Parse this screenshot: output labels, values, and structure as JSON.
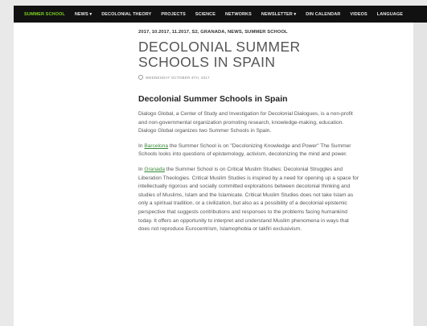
{
  "nav": {
    "items": [
      "SUMMER SCHOOL",
      "NEWS ▾",
      "DECOLONIAL THEORY",
      "PROJECTS",
      "SCIENCE",
      "NETWORKS",
      "NEWSLETTER ▾",
      "DIN CALENDAR",
      "VIDEOS",
      "LANGUAGE"
    ]
  },
  "post": {
    "meta": "2017, 10.2017, 11.2017, S2, GRANADA, NEWS, SUMMER SCHOOL",
    "title": "DECOLONIAL SUMMER SCHOOLS IN SPAIN",
    "date": "WEDNESDAY OCTOBER 4TH, 2017",
    "heading": "Decolonial Summer Schools in Spain",
    "p1": "Dialogo Global, a Center of Study and Investigation for Decolonial Dialogues, is a non-profit and non-governmental organization promoting research, knowledge-making, education. Dialogo Global organizes two Summer Schools in Spain.",
    "p2_prefix": "In ",
    "p2_link": "Barcelona",
    "p2_text": " the Summer School is on \"Decolonizing Knowledge and Power\" The Summer Schools looks into questions of epistemology, activism, decolonizing the mind and power.",
    "p3_prefix": "In ",
    "p3_link": "Granada",
    "p3_text": " the Summer School is on Critical Muslim Studies: Decolonial Struggles and Liberation Theologies. Critical Muslim Studies is inspired by a need for opening up a space for intellectually rigorous and socially committed explorations between decolonial thinking and studies of Muslims, Islam and the Islamicate. Critical Muslim Studies does not take Islam as only a spiritual tradition, or a civilization, but also as a possibility of a decolonial epistemic perspective that suggests contributions and responses to the problems facing humankind today. It offers an opportunity to interpret and understand Muslim phenomena in ways that does not reproduce Eurocentrism, Islamophobia or takfiri exclusivism."
  }
}
